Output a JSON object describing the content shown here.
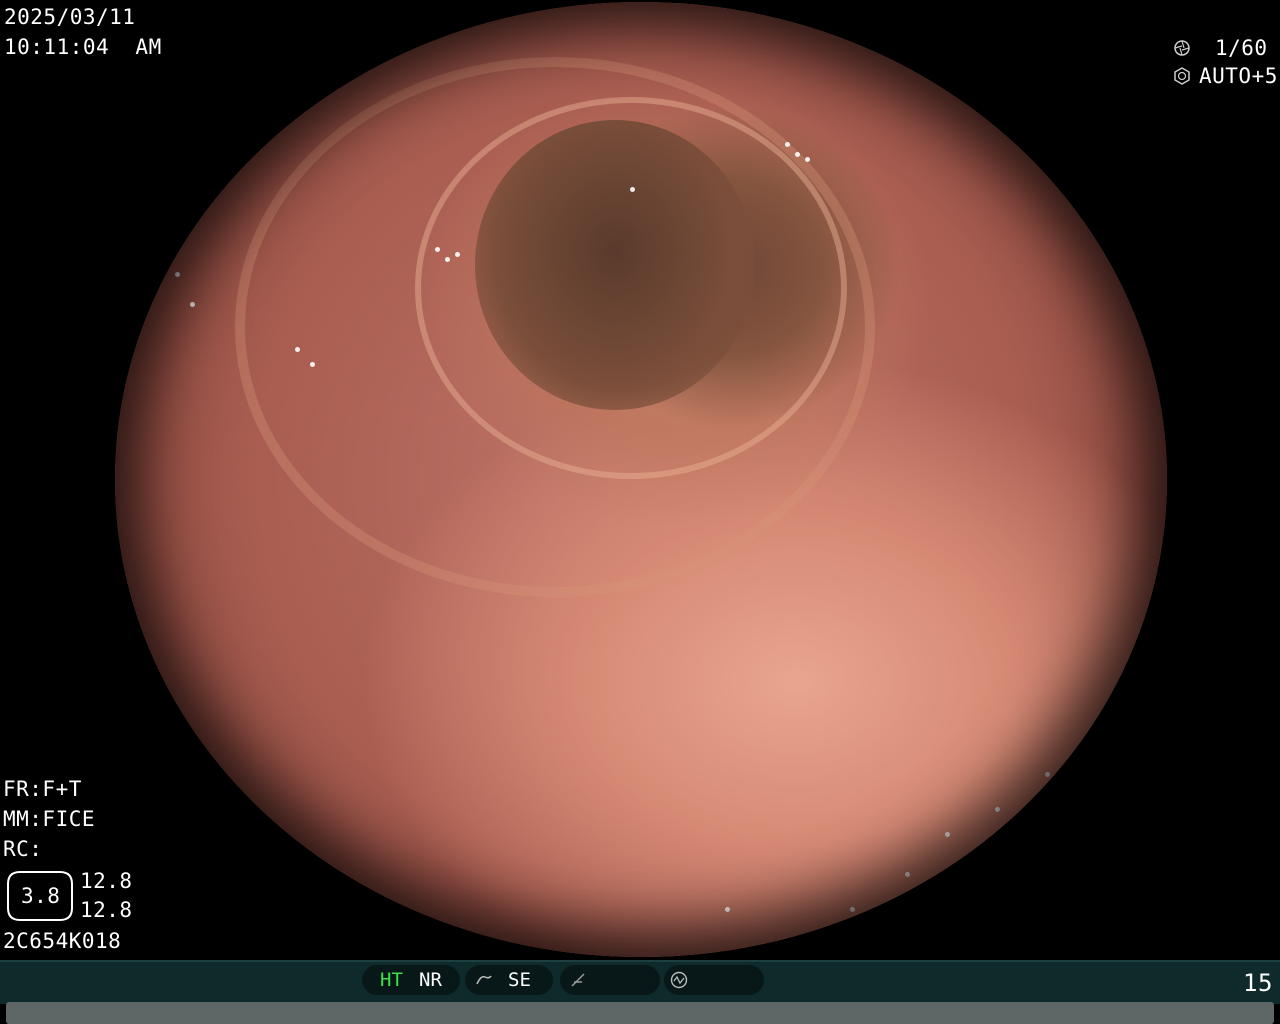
{
  "overlay": {
    "date": "2025/03/11",
    "time": "10:11:04  AM",
    "shutter": "1/60",
    "iris": "AUTO+5",
    "fr": "FR:F+T",
    "mm": "MM:FICE",
    "rc": "RC:",
    "ring_value": "3.8",
    "val_top": "12.8",
    "val_bottom": "12.8",
    "scope_id": "2C654K018"
  },
  "statusbar": {
    "ht": "HT",
    "nr": "NR",
    "se": "SE",
    "frame_count": "15"
  },
  "colors": {
    "ht_active": "#3ee04a",
    "bar_bg": "#0e2a2a"
  },
  "icons": [
    "shutter-icon",
    "iris-icon",
    "curve-icon",
    "edge-icon",
    "waveform-icon"
  ]
}
